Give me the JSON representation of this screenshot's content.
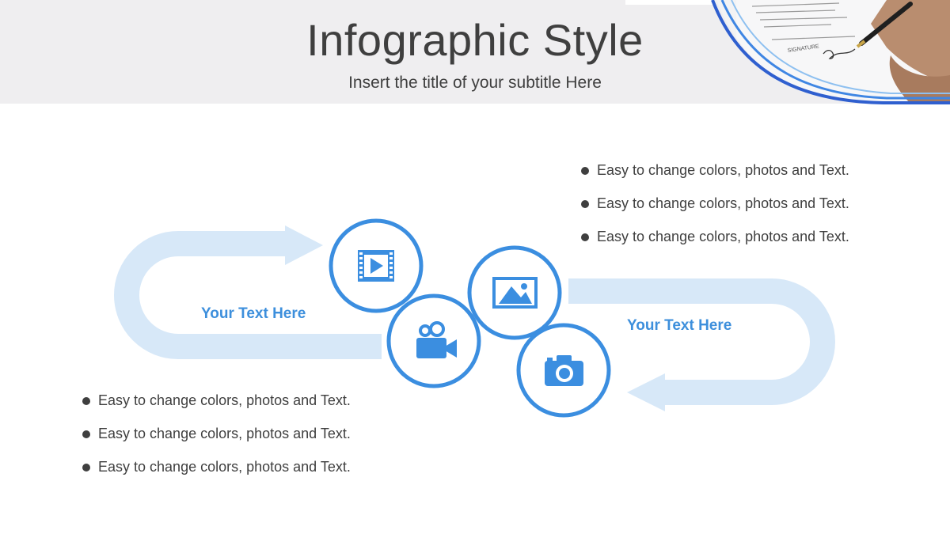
{
  "header": {
    "title": "Infographic Style",
    "subtitle": "Insert the title of your subtitle Here"
  },
  "colors": {
    "accent": "#3b8ee0",
    "flow": "#d7e8f8",
    "text": "#3f3f3f",
    "header_bg": "#efeef0"
  },
  "labels": {
    "left": "Your Text  Here",
    "right": "Your Text  Here"
  },
  "icons": [
    "film-icon",
    "image-icon",
    "video-camera-icon",
    "camera-icon"
  ],
  "bullets_top": [
    "Easy to change colors, photos and Text.",
    "Easy to change colors, photos and Text.",
    "Easy to change colors, photos and Text."
  ],
  "bullets_bottom": [
    "Easy to change colors, photos and Text.",
    "Easy to change colors, photos and Text.",
    "Easy to change colors, photos and Text."
  ]
}
